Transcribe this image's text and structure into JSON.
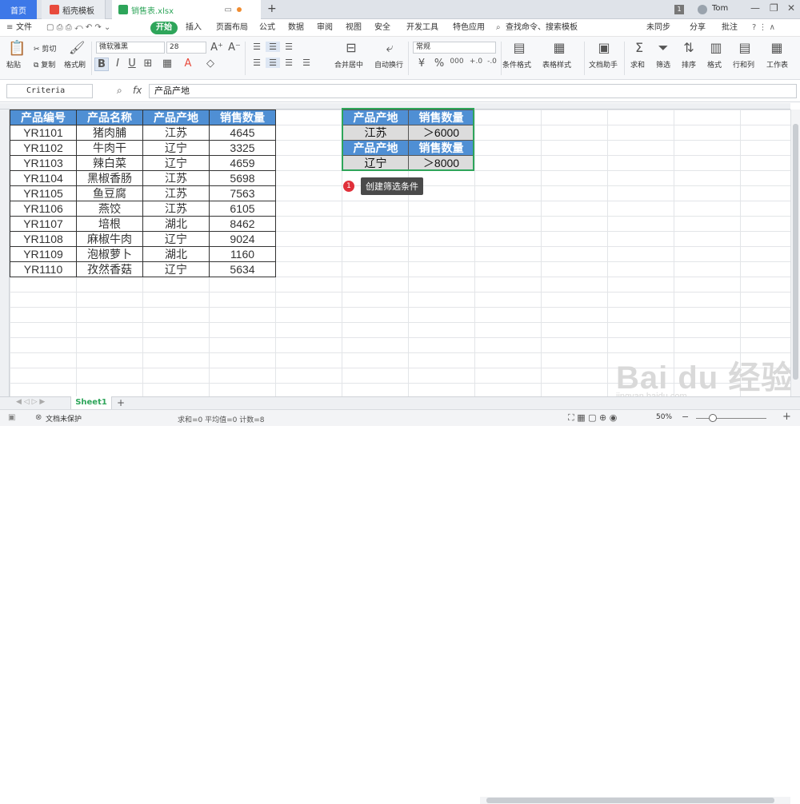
{
  "titlebar": {
    "tabs": [
      {
        "label": "首页"
      },
      {
        "label": "稻壳模板"
      },
      {
        "label": "销售表.xlsx"
      }
    ],
    "user": "Tom",
    "badge": "1"
  },
  "menu": {
    "items": [
      "文件",
      "开始",
      "插入",
      "页面布局",
      "公式",
      "数据",
      "审阅",
      "视图",
      "安全",
      "开发工具",
      "特色应用"
    ],
    "search_placeholder": "查找命令、搜索模板",
    "right": [
      "未同步",
      "分享",
      "批注"
    ]
  },
  "toolbar": {
    "paste": "粘贴",
    "cut": "剪切",
    "copy": "复制",
    "format_painter": "格式刷",
    "font": "微软雅黑",
    "size": "28",
    "bold": "B",
    "italic": "I",
    "underline": "U",
    "merge": "合并居中",
    "wrap": "自动换行",
    "number_format": "常规",
    "percent": "%",
    "cond_format": "条件格式",
    "table_style": "表格样式",
    "doc_helper": "文档助手",
    "sum": "求和",
    "filter": "筛选",
    "sort": "排序",
    "format": "格式",
    "rows_cols": "行和列",
    "worksheet": "工作表"
  },
  "formula_bar": {
    "name_box": "Criteria",
    "fx": "fx",
    "value": "产品产地"
  },
  "table": {
    "headers": [
      "产品编号",
      "产品名称",
      "产品产地",
      "销售数量"
    ],
    "rows": [
      [
        "YR1101",
        "猪肉脯",
        "江苏",
        "4645"
      ],
      [
        "YR1102",
        "牛肉干",
        "辽宁",
        "3325"
      ],
      [
        "YR1103",
        "辣白菜",
        "辽宁",
        "4659"
      ],
      [
        "YR1104",
        "黑椒香肠",
        "江苏",
        "5698"
      ],
      [
        "YR1105",
        "鱼豆腐",
        "江苏",
        "7563"
      ],
      [
        "YR1106",
        "燕饺",
        "江苏",
        "6105"
      ],
      [
        "YR1107",
        "培根",
        "湖北",
        "8462"
      ],
      [
        "YR1108",
        "麻椒牛肉",
        "辽宁",
        "9024"
      ],
      [
        "YR1109",
        "泡椒萝卜",
        "湖北",
        "1160"
      ],
      [
        "YR1110",
        "孜然香菇",
        "辽宁",
        "5634"
      ]
    ]
  },
  "criteria": {
    "rows": [
      {
        "h1": "产品产地",
        "h2": "销售数量",
        "v1": "江苏",
        "v2": "＞6000"
      },
      {
        "h1": "产品产地",
        "h2": "销售数量",
        "v1": "辽宁",
        "v2": "＞8000"
      }
    ]
  },
  "hint": {
    "num": "1",
    "text": "创建筛选条件"
  },
  "sheets": [
    "Sheet1"
  ],
  "status": {
    "protect": "文档未保护",
    "stats": "求和=0  平均值=0  计数=8",
    "zoom": "50%"
  },
  "watermark": {
    "brand": "Bai du 经验",
    "url": "jingyan.baidu.com"
  },
  "colors": {
    "accent": "#2ea55a",
    "header_blue": "#4f8fd4",
    "home_tab": "#3d78e8"
  }
}
